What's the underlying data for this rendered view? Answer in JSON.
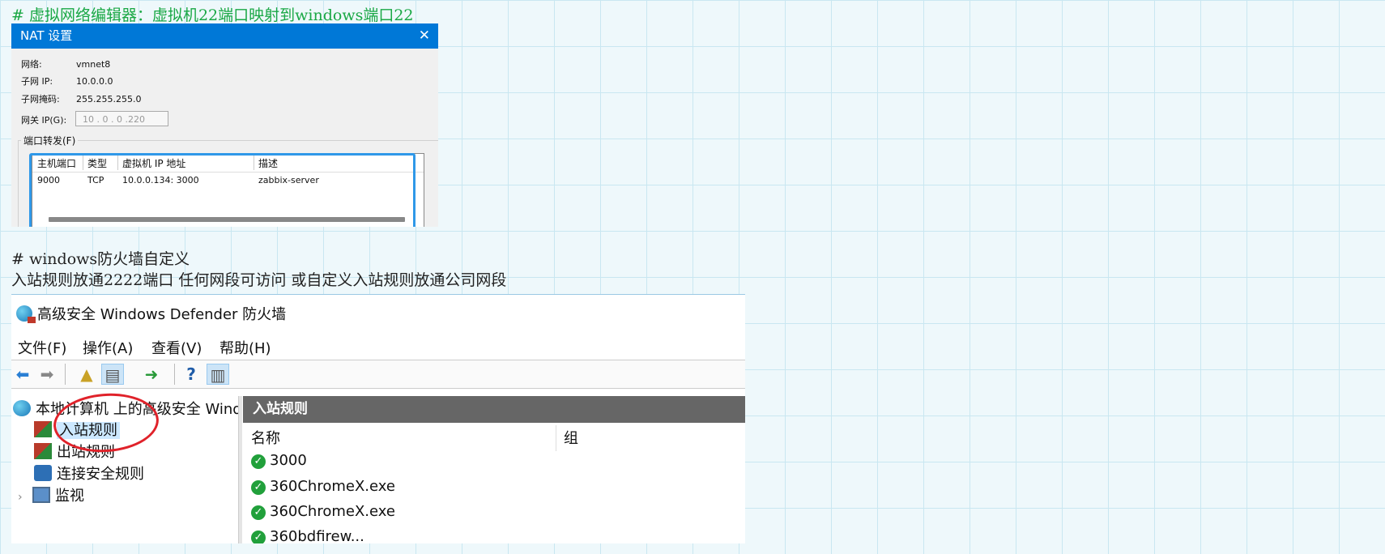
{
  "notes": {
    "vmnet_heading": "# 虚拟网络编辑器：虚拟机22端口映射到windows端口22",
    "firewall_heading": "# windows防火墙自定义",
    "firewall_desc": "入站规则放通2222端口 任何网段可访问 或自定义入站规则放通公司网段"
  },
  "nat_dialog": {
    "title": "NAT 设置",
    "network_label": "网络:",
    "network_value": "vmnet8",
    "subnet_ip_label": "子网 IP:",
    "subnet_ip_value": "10.0.0.0",
    "subnet_mask_label": "子网掩码:",
    "subnet_mask_value": "255.255.255.0",
    "gateway_label": "网关 IP(G):",
    "gateway_value": "10 . 0 . 0 .220",
    "port_forward_label": "端口转发(F)",
    "columns": [
      "主机端口",
      "类型",
      "虚拟机 IP 地址",
      "描述"
    ],
    "rows": [
      {
        "host_port": "9000",
        "type": "TCP",
        "vm_address": "10.0.0.134: 3000",
        "description": "zabbix-server"
      }
    ]
  },
  "firewall": {
    "title": "高级安全 Windows Defender 防火墙",
    "menu": [
      "文件(F)",
      "操作(A)",
      "查看(V)",
      "帮助(H)"
    ],
    "tree": {
      "root": "本地计算机 上的高级安全 Wind",
      "inbound": "入站规则",
      "outbound": "出站规则",
      "connection_security": "连接安全规则",
      "monitoring": "监视"
    },
    "pane_title": "入站规则",
    "columns": {
      "name": "名称",
      "group": "组"
    },
    "rules": [
      "3000",
      "360ChromeX.exe",
      "360ChromeX.exe",
      "360bdfirew..."
    ]
  },
  "colors": {
    "dialog_titlebar": "#0078d7",
    "highlight_box": "#2f98e8",
    "annotation_circle": "#e0222a",
    "rule_enabled": "#21a03b",
    "note_green": "#1aa845"
  }
}
